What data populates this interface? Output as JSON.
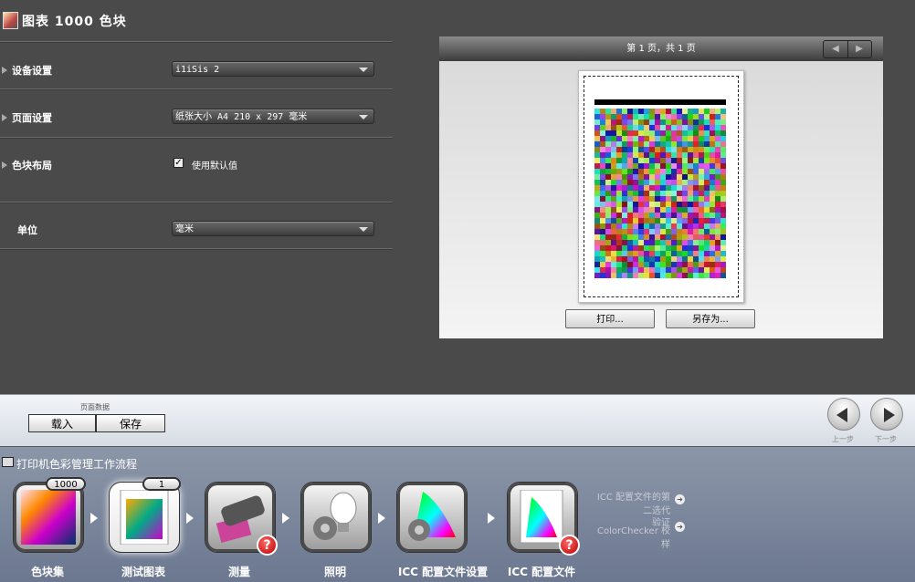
{
  "header": {
    "title": "图表 1000 色块"
  },
  "settings": {
    "device": {
      "label": "设备设置",
      "value": "i1iSis 2"
    },
    "page": {
      "label": "页面设置",
      "value": "纸张大小 A4 210 x 297 毫米"
    },
    "layout": {
      "label": "色块布局",
      "checkbox_label": "使用默认值",
      "checked": true
    },
    "units": {
      "label": "单位",
      "value": "毫米"
    }
  },
  "preview": {
    "page_indicator": "第 1 页，共 1 页",
    "print_button": "打印...",
    "save_as_button": "另存为..."
  },
  "page_data": {
    "label": "页面数据",
    "load_button": "载入",
    "save_button": "保存"
  },
  "navigation": {
    "prev_label": "上一步",
    "next_label": "下一步"
  },
  "workflow": {
    "title": "打印机色彩管理工作流程",
    "steps": [
      {
        "label": "色块集",
        "badge": "1000",
        "icon": "patch-set-icon"
      },
      {
        "label": "测试图表",
        "badge": "1",
        "icon": "test-chart-icon"
      },
      {
        "label": "测量",
        "icon": "measure-icon",
        "warning": "?"
      },
      {
        "label": "照明",
        "icon": "lighting-icon"
      },
      {
        "label": "ICC 配置文件设置",
        "icon": "icc-settings-icon"
      },
      {
        "label": "ICC 配置文件",
        "icon": "icc-profile-icon",
        "warning": "?"
      }
    ],
    "extra_options": [
      {
        "line1": "ICC 配置文件的第",
        "line2": "二选代",
        "line3": "验证"
      },
      {
        "line1": "ColorChecker 校",
        "line2": "样"
      }
    ]
  }
}
